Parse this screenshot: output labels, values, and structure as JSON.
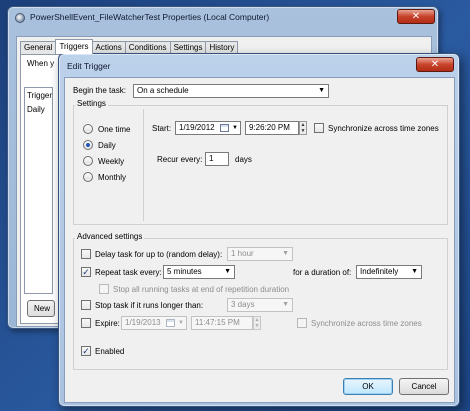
{
  "properties_window": {
    "title": "PowerShellEvent_FileWatcherTest Properties (Local Computer)",
    "close_glyph": "✕",
    "tabs": [
      {
        "label": "General"
      },
      {
        "label": "Triggers"
      },
      {
        "label": "Actions"
      },
      {
        "label": "Conditions"
      },
      {
        "label": "Settings"
      },
      {
        "label": "History"
      }
    ],
    "hint": "When y",
    "list": {
      "column": "Trigger",
      "rows": [
        "Daily"
      ]
    },
    "new_button": "New"
  },
  "edit_trigger": {
    "title": "Edit Trigger",
    "close_glyph": "✕",
    "begin_task_label": "Begin the task:",
    "begin_task_value": "On a schedule",
    "settings_label": "Settings",
    "schedule_options": [
      {
        "label": "One time",
        "selected": false
      },
      {
        "label": "Daily",
        "selected": true
      },
      {
        "label": "Weekly",
        "selected": false
      },
      {
        "label": "Monthly",
        "selected": false
      }
    ],
    "start_label": "Start:",
    "start_date": "1/19/2012",
    "start_time": "9:26:20 PM",
    "sync_time_zones_label": "Synchronize across time zones",
    "recur_label": "Recur every:",
    "recur_value": "1",
    "recur_unit": "days",
    "advanced_label": "Advanced settings",
    "delay": {
      "label": "Delay task for up to (random delay):",
      "value": "1 hour",
      "checked": false
    },
    "repeat": {
      "label": "Repeat task every:",
      "value": "5 minutes",
      "checked": true,
      "duration_label": "for a duration of:",
      "duration_value": "Indefinitely"
    },
    "stop_running": {
      "label": "Stop all running tasks at end of repetition duration",
      "checked": false
    },
    "stop_longer": {
      "label": "Stop task if it runs longer than:",
      "value": "3 days",
      "checked": false
    },
    "expire": {
      "label": "Expire:",
      "date": "1/19/2013",
      "time": "11:47:15 PM",
      "checked": false,
      "sync_label": "Synchronize across time zones"
    },
    "enabled": {
      "label": "Enabled",
      "checked": true
    },
    "check_mark": "✓",
    "ok_label": "OK",
    "cancel_label": "Cancel",
    "dropdown_arrow": "▼",
    "spin_up": "▲",
    "spin_down": "▼"
  }
}
